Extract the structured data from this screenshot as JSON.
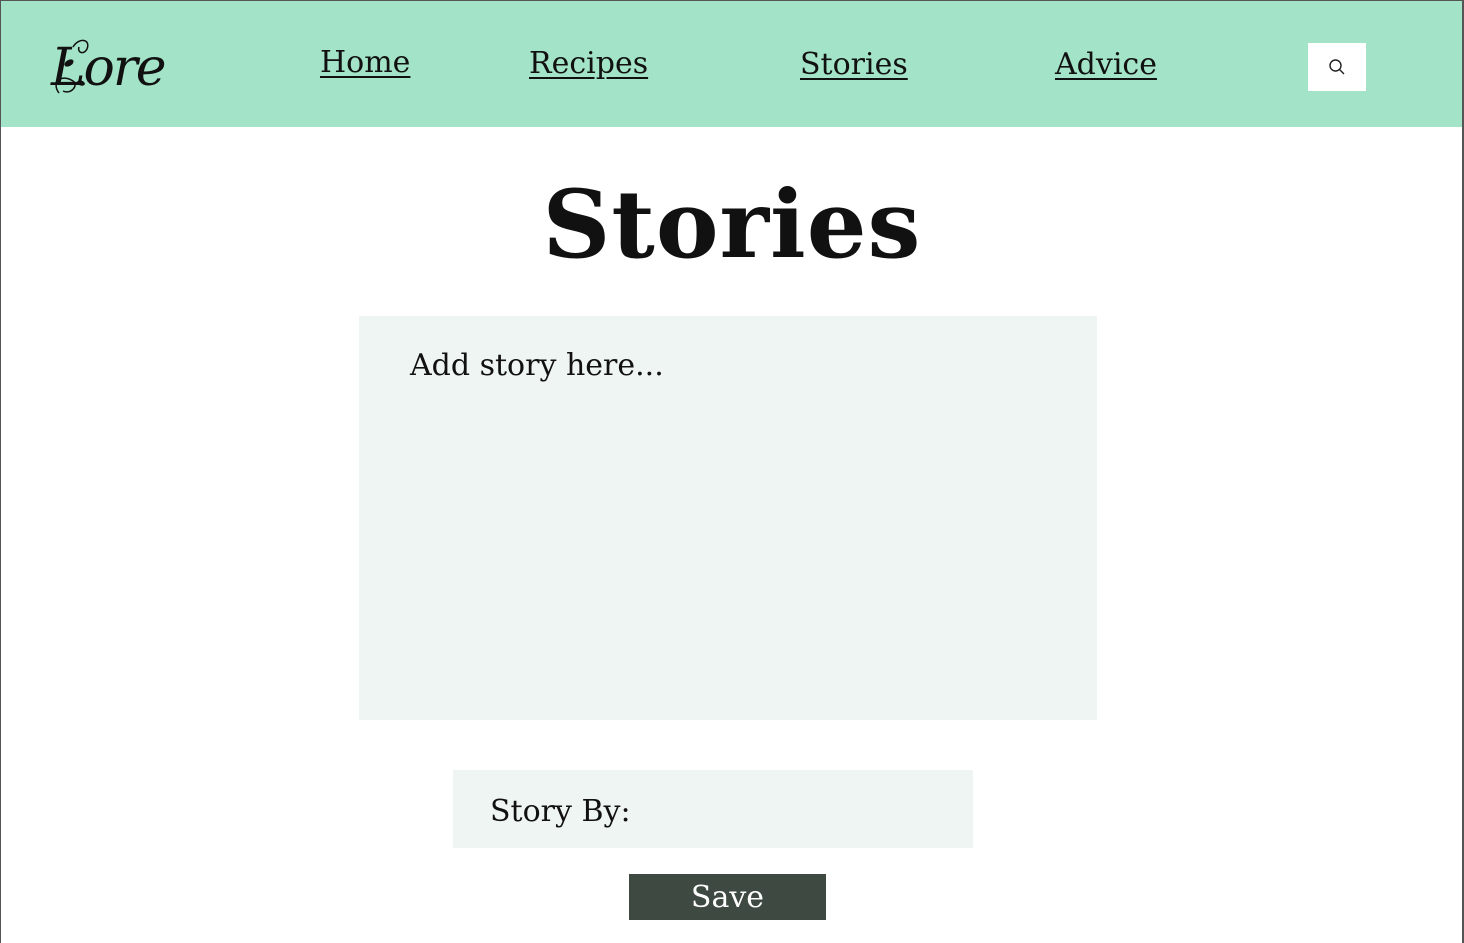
{
  "header": {
    "logo_text": "Lore",
    "nav": [
      {
        "label": "Home"
      },
      {
        "label": "Recipes"
      },
      {
        "label": "Stories"
      },
      {
        "label": "Advice"
      }
    ],
    "search_icon": "search-icon"
  },
  "main": {
    "title": "Stories",
    "story_input": {
      "placeholder": "Add story here...",
      "value": ""
    },
    "story_by": {
      "label": "Story By:",
      "value": ""
    },
    "save_label": "Save"
  },
  "colors": {
    "header_bg": "#a3e3c7",
    "input_bg": "#eff5f2",
    "button_bg": "#3e4a41",
    "button_text": "#ffffff"
  }
}
